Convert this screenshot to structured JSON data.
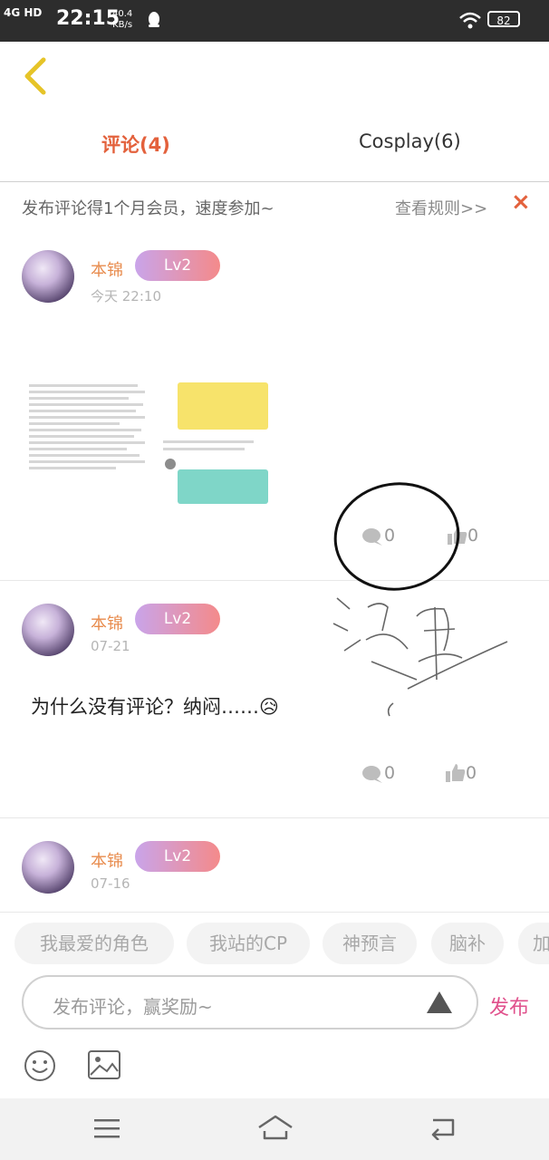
{
  "status": {
    "network": "4G HD",
    "time": "22:15",
    "speed_value": "40.4",
    "speed_unit": "KB/s",
    "battery": "82"
  },
  "tabs": [
    {
      "label": "评论(4)"
    },
    {
      "label": "Cosplay(6)"
    }
  ],
  "promo": {
    "text": "发布评论得1个月会员，速度参加~",
    "rules": "查看规则>>",
    "close": "×"
  },
  "comments": [
    {
      "name": "本锦",
      "level": "Lv2",
      "time": "今天 22:10",
      "reply_count": "0",
      "like_count": "0"
    },
    {
      "name": "本锦",
      "level": "Lv2",
      "time": "07-21",
      "text": "为什么没有评论？纳闷……😥",
      "reply_count": "0",
      "like_count": "0"
    },
    {
      "name": "本锦",
      "level": "Lv2",
      "time": "07-16"
    }
  ],
  "chips": [
    "我最爱的角色",
    "我站的CP",
    "神预言",
    "脑补",
    "加"
  ],
  "input": {
    "placeholder": "发布评论，赢奖励~",
    "publish": "发布"
  },
  "colors": {
    "accent_red": "#e3613c",
    "publish_pink": "#e0518c",
    "level_gradient": [
      "#c9a4ea",
      "#f48a8a"
    ],
    "username": "#e88c4e"
  }
}
